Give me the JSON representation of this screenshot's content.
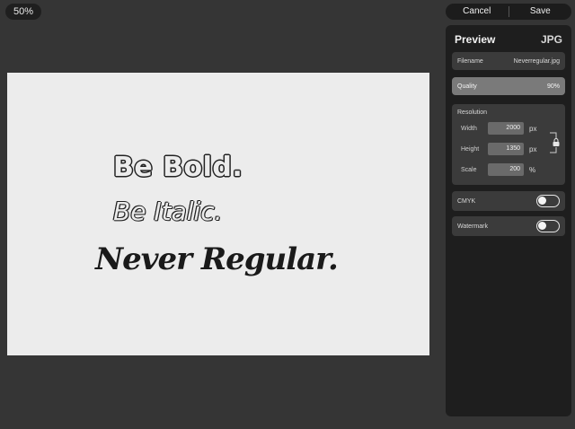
{
  "zoom": "50%",
  "actions": {
    "cancel": "Cancel",
    "save": "Save"
  },
  "canvas_text": {
    "line1": "Be Bold.",
    "line2": "Be Italic.",
    "line3": "Never Regular."
  },
  "panel": {
    "title": "Preview",
    "format": "JPG",
    "filename_label": "Filename",
    "filename_value": "Neverregular.jpg",
    "quality_label": "Quality",
    "quality_value": "90%",
    "resolution_label": "Resolution",
    "width_label": "Width",
    "width_value": "2000",
    "width_unit": "px",
    "height_label": "Height",
    "height_value": "1350",
    "height_unit": "px",
    "scale_label": "Scale",
    "scale_value": "200",
    "scale_unit": "%",
    "cmyk_label": "CMYK",
    "cmyk_on": false,
    "watermark_label": "Watermark",
    "watermark_on": false
  },
  "icons": {
    "lock": "lock-icon"
  }
}
